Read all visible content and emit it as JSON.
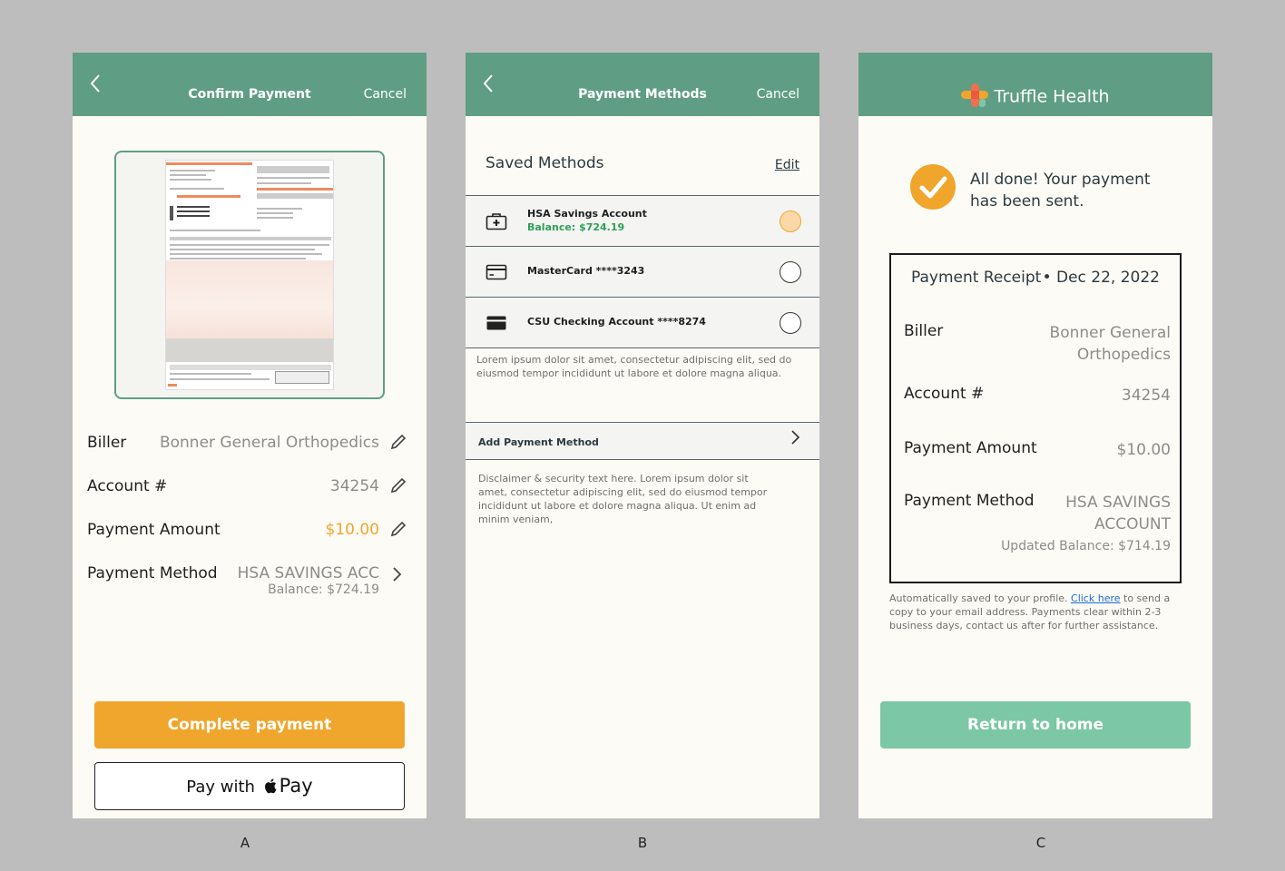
{
  "screens": {
    "a": {
      "label": "A",
      "header": {
        "title": "Confirm Payment",
        "cancel": "Cancel"
      },
      "rows": {
        "biller": {
          "label": "Biller",
          "value": "Bonner General Orthopedics"
        },
        "account": {
          "label": "Account #",
          "value": "34254"
        },
        "amount": {
          "label": "Payment Amount",
          "value": "$10.00"
        },
        "method": {
          "label": "Payment Method",
          "value": "HSA SAVINGS ACC",
          "sub": "Balance: $724.19"
        }
      },
      "complete_button": "Complete payment",
      "apple_pay": {
        "prefix": "Pay with",
        "pay": "Pay"
      }
    },
    "b": {
      "label": "B",
      "header": {
        "title": "Payment Methods",
        "cancel": "Cancel"
      },
      "saved_title": "Saved Methods",
      "edit": "Edit",
      "methods": [
        {
          "name": "HSA Savings Account",
          "balance": "Balance: $724.19",
          "icon": "medical-case-icon",
          "selected": true
        },
        {
          "name": "MasterCard ****3243",
          "icon": "credit-card-outline-icon",
          "selected": false
        },
        {
          "name": "CSU Checking Account ****8274",
          "icon": "credit-card-filled-icon",
          "selected": false
        }
      ],
      "lorem": "Lorem ipsum dolor sit amet, consectetur adipiscing elit, sed do eiusmod tempor incididunt ut labore et dolore magna aliqua.",
      "add_method": "Add Payment Method",
      "disclaimer": "Disclaimer & security text here. Lorem ipsum dolor sit amet, consectetur adipiscing elit, sed do eiusmod tempor incididunt ut labore et dolore magna aliqua. Ut enim ad minim veniam,"
    },
    "c": {
      "label": "C",
      "brand": "Truffle Health",
      "done": "All done! Your payment has been sent.",
      "receipt": {
        "title": "Payment Receipt",
        "date": "• Dec 22, 2022",
        "biller": {
          "label": "Biller",
          "value_line1": "Bonner General",
          "value_line2": "Orthopedics"
        },
        "account": {
          "label": "Account #",
          "value": "34254"
        },
        "amount": {
          "label": "Payment Amount",
          "value": "$10.00"
        },
        "method": {
          "label": "Payment Method",
          "value_line1": "HSA SAVINGS",
          "value_line2": "ACCOUNT",
          "sub": "Updated Balance: $714.19"
        }
      },
      "footnote": {
        "before": "Automatically saved to your profile. ",
        "link": "Click here",
        "after": " to send a copy to your email address. Payments clear within 2-3 business days, contact us after for further assistance."
      },
      "home_button": "Return to home"
    }
  },
  "colors": {
    "header": "#5f9e84",
    "accent_orange": "#f0a62c",
    "home_button": "#7bc7a6",
    "balance_green": "#2fa05a",
    "screen_bg": "#fdfbf5"
  }
}
